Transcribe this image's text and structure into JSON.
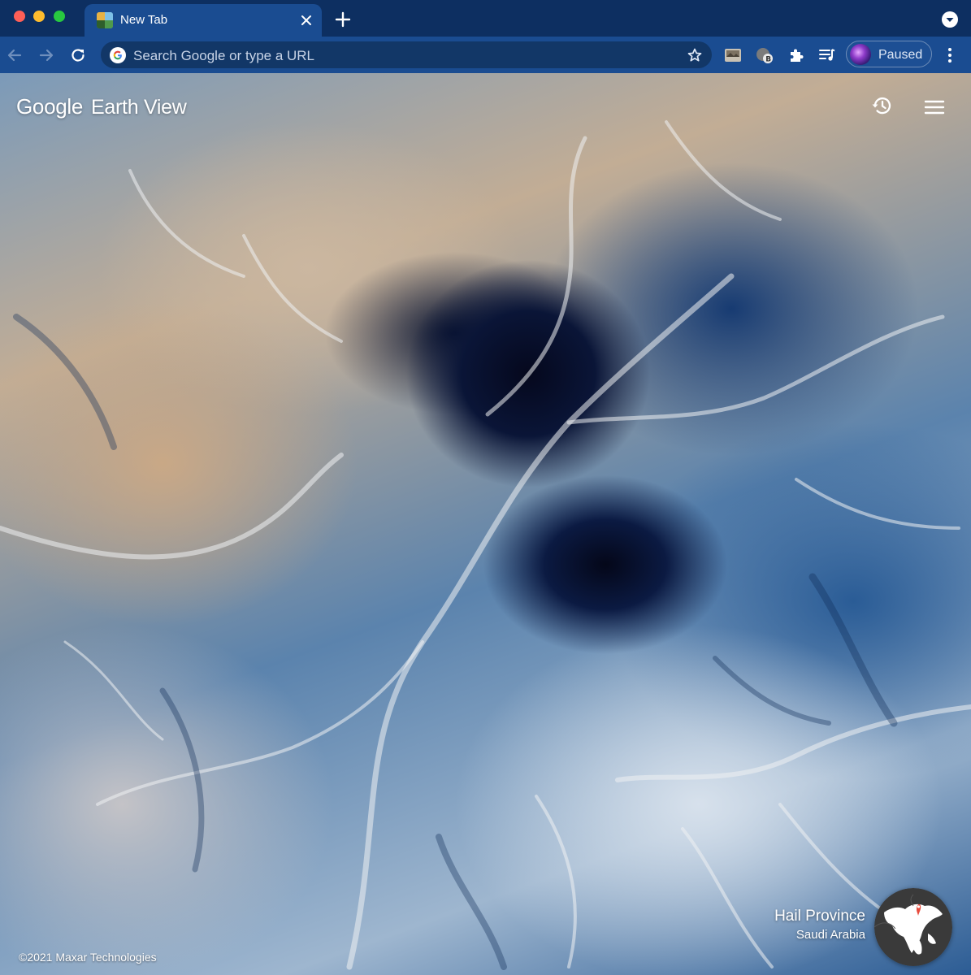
{
  "browser": {
    "tab": {
      "title": "New Tab",
      "favicon": "earth-view-favicon",
      "close_icon": "close-icon"
    },
    "new_tab_icon": "plus-icon",
    "tab_search_icon": "chevron-down-icon",
    "toolbar": {
      "back_icon": "arrow-left-icon",
      "forward_icon": "arrow-right-icon",
      "reload_icon": "reload-icon",
      "omnibox": {
        "placeholder": "Search Google or type a URL",
        "search_engine_icon": "google-g-icon",
        "bookmark_icon": "star-icon"
      },
      "extensions": [
        "image-extension-icon",
        "bitwarden-extension-icon",
        "puzzle-icon",
        "media-queue-icon"
      ],
      "profile": {
        "label": "Paused",
        "avatar": "profile-avatar"
      },
      "menu_icon": "kebab-menu-icon"
    }
  },
  "earth_view": {
    "brand": {
      "company": "Google",
      "product": "Earth View"
    },
    "history_icon": "history-icon",
    "menu_icon": "hamburger-icon",
    "location": {
      "name": "Hail Province",
      "country": "Saudi Arabia"
    },
    "globe_icon": "globe-icon",
    "copyright": "©2021 Maxar Technologies"
  },
  "colors": {
    "titlebar": "#0d2f61",
    "toolbar": "#1a4c91",
    "omnibox": "#123767",
    "map_pin": "#e84b3c"
  }
}
